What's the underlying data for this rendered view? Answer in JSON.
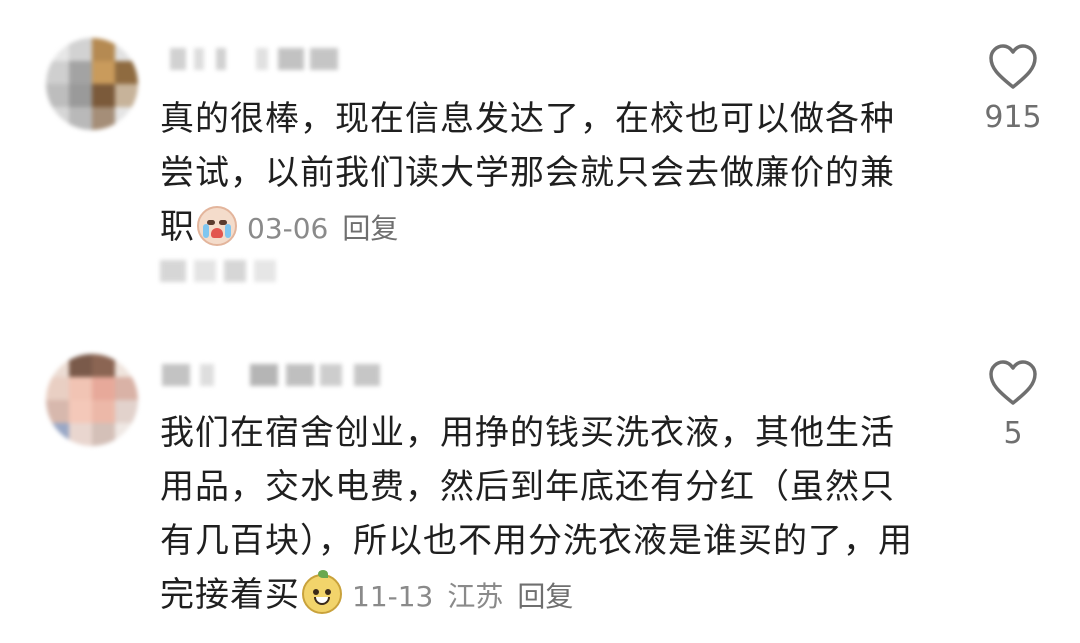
{
  "comments": [
    {
      "text": "真的很棒，现在信息发达了，在校也可以做各种尝试，以前我们读大学那会就只会去做廉价的兼职",
      "emoji": "cry-face-icon",
      "date": "03-06",
      "location": "",
      "reply_label": "回复",
      "likes": "915"
    },
    {
      "text": "我们在宿舍创业，用挣的钱买洗衣液，其他生活用品，交水电费，然后到年底还有分红（虽然只有几百块），所以也不用分洗衣液是谁买的了，用完接着买",
      "emoji": "pear-grin-icon",
      "date": "11-13",
      "location": "江苏",
      "reply_label": "回复",
      "likes": "5"
    }
  ],
  "colors": {
    "text": "#1f1f1f",
    "meta": "#8a8a8a",
    "heart_outline": "#6f6f6f",
    "background": "#ffffff"
  }
}
